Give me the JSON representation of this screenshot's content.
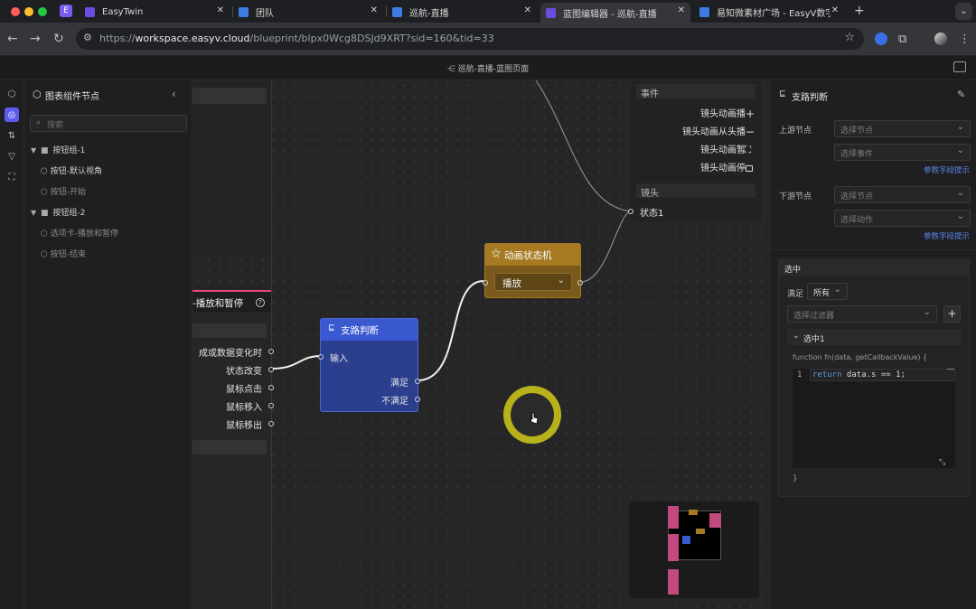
{
  "browser": {
    "tabs": [
      {
        "title": "EasyTwin",
        "active": false
      },
      {
        "title": "团队",
        "active": false
      },
      {
        "title": "巡航-直播",
        "active": false
      },
      {
        "title": "蓝图编辑器 - 巡航-直播",
        "active": true
      },
      {
        "title": "易知微素材广场 - EasyV数字孪",
        "active": false
      }
    ],
    "new_tab": "+",
    "url_prefix": "https://",
    "url_host": "workspace.easyv.cloud",
    "url_path": "/blueprint/blpx0Wcg8DSJd9XRT?sid=160&tid=33"
  },
  "app": {
    "breadcrumb": "巡航-直播-蓝图页面"
  },
  "left_panel": {
    "title": "图表组件节点",
    "search_placeholder": "搜索",
    "tree": [
      {
        "label": "按钮组-1",
        "type": "group"
      },
      {
        "label": "按钮-默认视角",
        "type": "item"
      },
      {
        "label": "按钮-开始",
        "type": "item"
      },
      {
        "label": "按钮组-2",
        "type": "group"
      },
      {
        "label": "选项卡-播放和暂停",
        "type": "item"
      },
      {
        "label": "按钮-结束",
        "type": "item"
      }
    ]
  },
  "canvas": {
    "top_right_node": {
      "events_header": "事件",
      "events": [
        "镜头动画播",
        "镜头动画从头播",
        "镜头动画暂",
        "镜头动画停"
      ],
      "camera_header": "镜头",
      "camera_port": "状态1"
    },
    "tab_node": {
      "title": "-播放和暂停",
      "outputs": [
        "成或数据变化时",
        "状态改变",
        "鼠标点击",
        "鼠标移入",
        "鼠标移出"
      ]
    },
    "branch_node": {
      "title": "支路判断",
      "input": "输入",
      "outputs": [
        "满足",
        "不满足"
      ]
    },
    "animation_node": {
      "title": "动画状态机",
      "select_value": "播放"
    },
    "zoom_controls": [
      "+",
      "−",
      "⛶",
      "🔓"
    ]
  },
  "right_panel": {
    "title": "支路判断",
    "upstream_label": "上游节点",
    "upstream_node_placeholder": "选择节点",
    "upstream_event_placeholder": "选择事件",
    "param_link_1": "参数字段提示",
    "downstream_label": "下游节点",
    "downstream_node_placeholder": "选择节点",
    "downstream_action_placeholder": "选择动作",
    "param_link_2": "参数字段提示",
    "section_title": "选中",
    "satisfy_label": "满足",
    "satisfy_value": "所有",
    "filter_placeholder": "选择过滤器",
    "sub_title": "选中1",
    "func_signature": "function fn(data, getCallbackValue) {",
    "code_line_no": "1",
    "code_keyword": "return",
    "code_rest": " data.s == 1;",
    "func_close": "}"
  },
  "colors": {
    "accent": "#5b5bf0",
    "branch_node": "#2f4db8",
    "animation_node": "#a67a22",
    "tab_node_border": "#e0457b",
    "link": "#5d86e8",
    "cursor_ring": "#d6d21c"
  }
}
